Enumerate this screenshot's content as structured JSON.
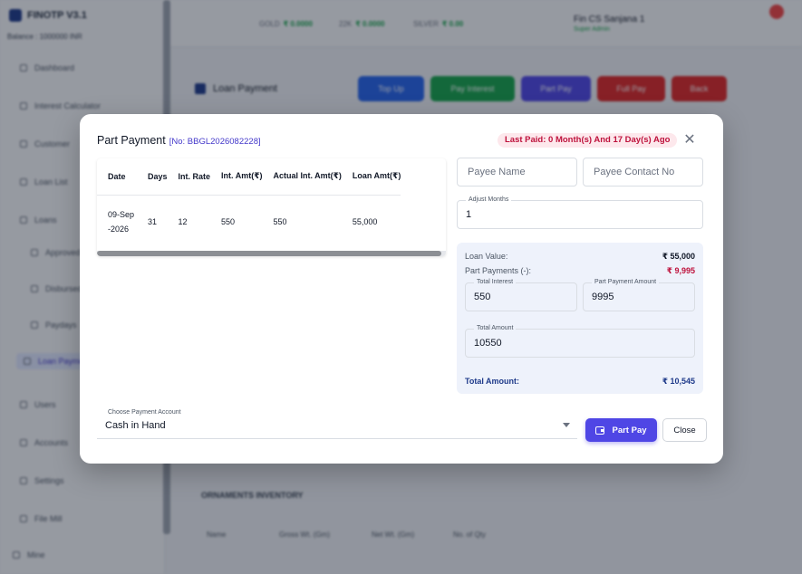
{
  "background": {
    "brand": "FINOTP V3.1",
    "balance": "Balance : 1000000 INR",
    "sidebar": [
      "Dashboard",
      "Interest Calculator",
      "Customer",
      "Loan List",
      "Loans",
      "Approved",
      "Disbursed",
      "Paydays",
      "Loan Payment",
      "Users",
      "Accounts",
      "Settings",
      "File Mill",
      "Mine"
    ],
    "topbar": {
      "gold_label": "GOLD",
      "gold_value": "₹ 0.0000",
      "gram_label": "22K",
      "gram_value": "₹ 0.0000",
      "silver_label": "SILVER",
      "silver_value": "₹ 0.00",
      "user_name": "Fin CS Sanjana 1",
      "user_role": "Super Admin"
    },
    "page_title": "Loan Payment",
    "action_buttons": [
      "Top Up",
      "Pay Interest",
      "Part Pay",
      "Full Pay",
      "Back"
    ],
    "section_title": "ORNAMENTS INVENTORY",
    "columns": [
      "Name",
      "Gross Wt. (Gm)",
      "Net Wt. (Gm)",
      "No. of Qty"
    ]
  },
  "modal": {
    "title": "Part Payment",
    "number": "[No: BBGL2026082228]",
    "last_paid": "Last Paid: 0 Month(s) And 17 Day(s) Ago",
    "table": {
      "headers": [
        "Date",
        "Days",
        "Int. Rate",
        "Int. Amt(₹)",
        "Actual Int. Amt(₹)",
        "Loan Amt(₹)"
      ],
      "row": [
        "09-Sep-2026",
        "31",
        "12",
        "550",
        "550",
        "55,000"
      ]
    },
    "payee_name_placeholder": "Payee Name",
    "payee_contact_placeholder": "Payee Contact No",
    "adjust_months_label": "Adjust Months",
    "adjust_months_value": "1",
    "summary": {
      "loan_value_label": "Loan Value:",
      "loan_value": "₹ 55,000",
      "part_payments_label": "Part Payments (-):",
      "part_payments": "₹ 9,995",
      "total_interest_label": "Total Interest",
      "total_interest": "550",
      "part_payment_amount_label": "Part Payment Amount",
      "part_payment_amount": "9995",
      "total_amount_field_label": "Total Amount",
      "total_amount_field": "10550",
      "total_label": "Total Amount:",
      "total_value": "₹ 10,545"
    },
    "payment_account_label": "Choose Payment Account",
    "payment_account_value": "Cash in Hand",
    "part_pay_label": "Part Pay",
    "close_label": "Close"
  },
  "colors": {
    "primary": "#4f46e5",
    "danger_text": "#be123c",
    "badge_bg": "#fde8ec",
    "summary_bg": "#eef2fb",
    "total_text": "#1e3a8a"
  }
}
